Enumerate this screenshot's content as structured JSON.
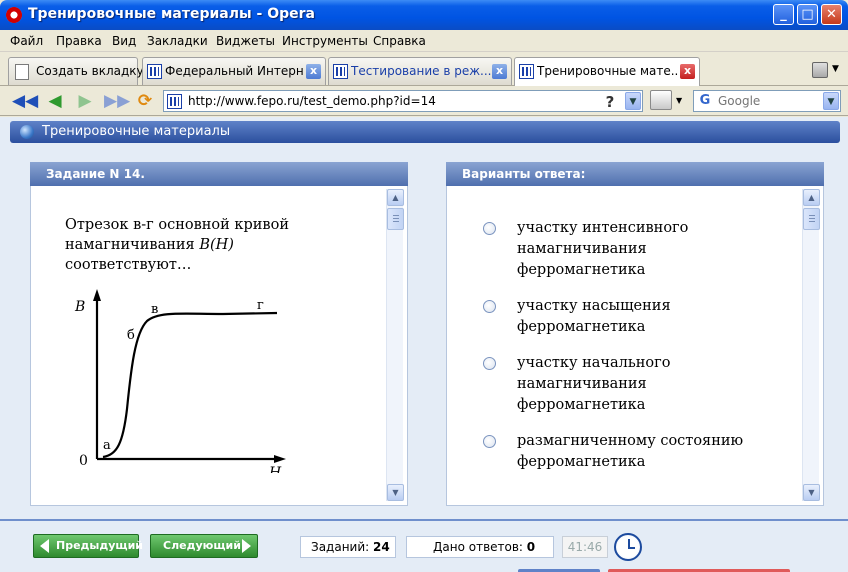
{
  "window": {
    "title": "Тренировочные материалы - Opera",
    "minimize": "_",
    "maximize": "□",
    "close": "✕"
  },
  "menu": [
    "Файл",
    "Правка",
    "Вид",
    "Закладки",
    "Виджеты",
    "Инструменты",
    "Справка"
  ],
  "tabs": {
    "new_tab": "Создать вкладку",
    "items": [
      {
        "label": "Федеральный Интерн..."
      },
      {
        "label": "Тестирование в реж..."
      },
      {
        "label": "Тренировочные матe..."
      }
    ],
    "close_glyph": "x"
  },
  "address": {
    "url": "http://www.fepo.ru/test_demo.php?id=14",
    "help": "?",
    "search_placeholder": "Google",
    "search_icon": "G"
  },
  "page": {
    "header": "Тренировочные материалы",
    "task_title": "Задание N 14.",
    "answers_title": "Варианты ответа:",
    "question_line1": "Отрезок в-г основной кривой",
    "question_line2_prefix": "намагничивания ",
    "question_line2_math": "B(H)",
    "question_line3": "соответствуют…",
    "graph": {
      "y_label": "B",
      "x_label": "H",
      "origin": "0",
      "point_a": "а",
      "point_b": "б",
      "point_v": "в",
      "point_g": "г"
    },
    "answers": [
      {
        "text": "участку интенсивного намагничивания ферромагнетика"
      },
      {
        "text": "участку насыщения ферромагнетика"
      },
      {
        "text": "участку начального намагничивания ферромагнетика"
      },
      {
        "text": "размагниченному состоянию ферромагнетика"
      }
    ]
  },
  "footer": {
    "prev": "Предыдущий",
    "next": "Следующий",
    "tasks_label": "Заданий:",
    "tasks_value": "24",
    "answered_label": "Дано ответов:",
    "answered_value": "0",
    "timer": "41:46"
  }
}
